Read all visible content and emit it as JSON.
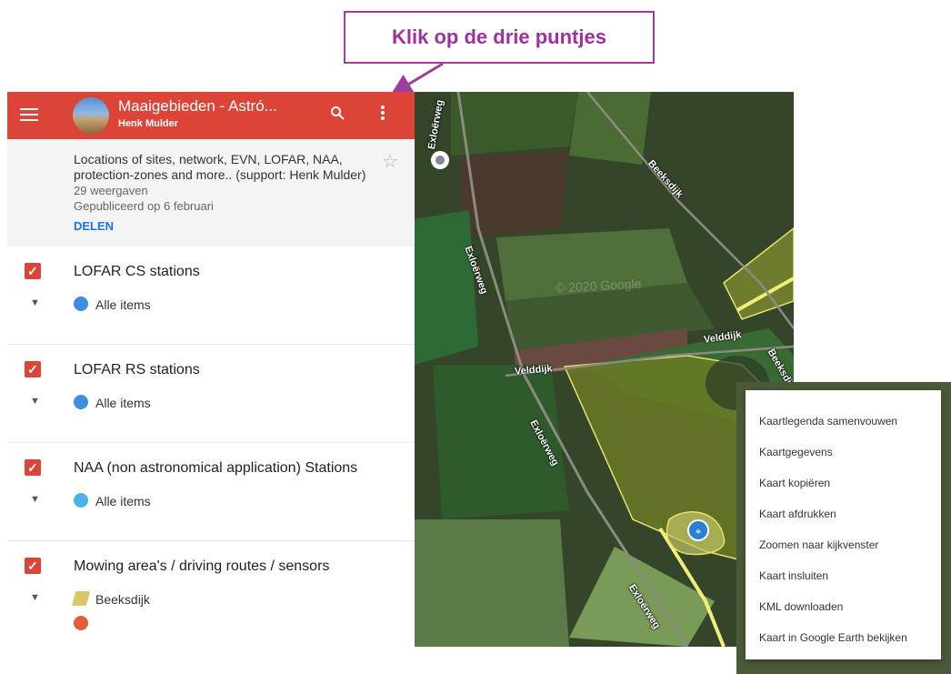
{
  "callout": {
    "text": "Klik op de drie puntjes"
  },
  "panel": {
    "title": "Maaigebieden - Astró...",
    "author": "Henk Mulder",
    "description": "Locations of sites, network, EVN, LOFAR, NAA, protection-zones and more.. (support: Henk Mulder)",
    "views": "29 weergaven",
    "published": "Gepubliceerd op 6 februari",
    "share_label": "DELEN",
    "layers": [
      {
        "title": "LOFAR CS stations",
        "item": "Alle items",
        "checked": true
      },
      {
        "title": "LOFAR RS stations",
        "item": "Alle items",
        "checked": true
      },
      {
        "title": "NAA (non astronomical application) Stations",
        "item": "Alle items",
        "checked": true
      },
      {
        "title": "Mowing area's / driving routes / sensors",
        "item": "Beeksdijk",
        "checked": true
      }
    ]
  },
  "map": {
    "road_labels": [
      "Exloërweg",
      "Exloërweg",
      "Exloërweg",
      "Beeksdijk",
      "Velddijk",
      "Velddijk",
      "Beeksdijk",
      "Exloërweg"
    ],
    "watermark": "© 2020 Google"
  },
  "context_menu": {
    "items": [
      "Kaartlegenda samenvouwen",
      "Kaartgegevens",
      "Kaart kopiëren",
      "Kaart afdrukken",
      "Zoomen naar kijkvenster",
      "Kaart insluiten",
      "KML downloaden",
      "Kaart in Google Earth bekijken"
    ]
  },
  "icons": {
    "menu": "hamburger-icon",
    "search": "search-icon",
    "more": "more-vert-icon",
    "star": "star-outline-icon",
    "checkbox": "checkbox-checked-icon",
    "chevron": "chevron-down-icon"
  },
  "colors": {
    "header": "#db4437",
    "accent": "#1a73e8",
    "callout": "#a0309f"
  }
}
